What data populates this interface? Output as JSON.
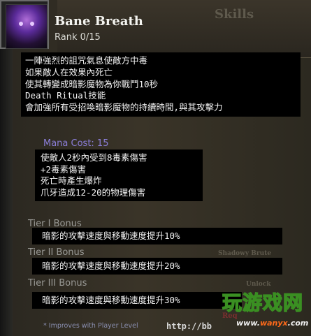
{
  "skill": {
    "title": "Bane Breath",
    "rank": "Rank 0/15",
    "icon": "wraith-portrait-icon"
  },
  "description": [
    "一陣強烈的詛咒氣息使敵方中毒",
    "如果敵人在效果內死亡",
    "使其轉變成暗影魔物為你戰鬥10秒",
    "Death Ritual技能",
    "會加強所有受招喚暗影魔物的持續時間,與其攻擊力"
  ],
  "mana_cost": "Mana Cost: 15",
  "effects": [
    "使敵人2秒內受到8毒素傷害",
    "+2毒素傷害",
    "死亡時產生爆炸",
    "爪牙造成12-20的物理傷害"
  ],
  "tiers": [
    {
      "label": "Tier I Bonus",
      "text": "暗影的攻擊速度與移動速度提升10%"
    },
    {
      "label": "Tier II Bonus",
      "text": "暗影的攻擊速度與移動速度提升20%"
    },
    {
      "label": "Tier III Bonus",
      "text": "暗影的攻擊速度與移動速度提升30%"
    }
  ],
  "background": {
    "skills_header": "Skills",
    "shadowy_brute": "Shadowy Brute",
    "unlock": "Unlock",
    "req": "Req"
  },
  "footer": {
    "note": "* Improves with Player Level",
    "url": "http://bb"
  },
  "watermark": {
    "main": "玩游戏网",
    "url_prefix": "www.",
    "url_brand": "wanyx",
    "url_suffix": ".com"
  },
  "colors": {
    "mana": "#8b7ed8",
    "tier_label": "#9a9a96",
    "text": "#f2f2f2"
  }
}
